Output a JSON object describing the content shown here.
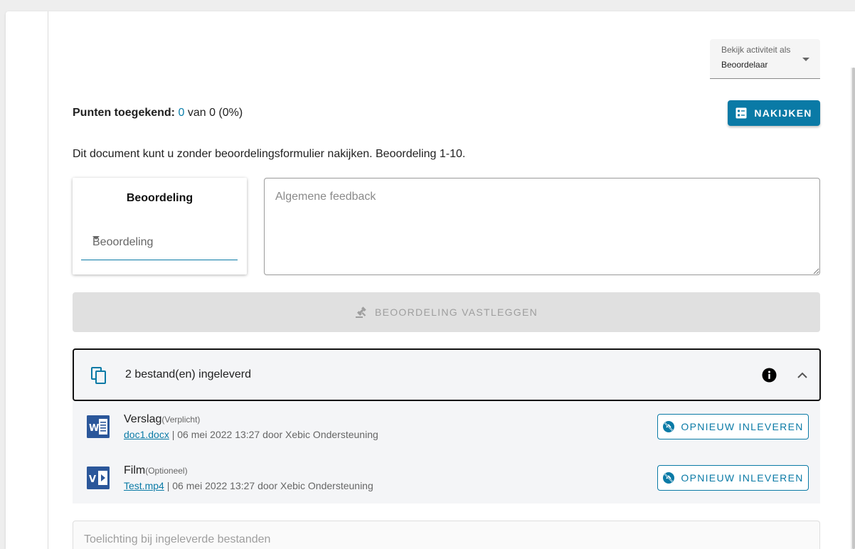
{
  "view_as": {
    "label": "Bekijk activiteit als",
    "value": "Beoordelaar"
  },
  "points": {
    "label": "Punten toegekend:",
    "awarded": "0",
    "rest": " van 0 (0%)"
  },
  "grade_button_label": "NAKIJKEN",
  "info_text": "Dit document kunt u zonder beoordelingsformulier nakijken. Beoordeling 1-10.",
  "grade_card": {
    "title": "Beoordeling",
    "select_placeholder": "Beoordeling"
  },
  "feedback_placeholder": "Algemene feedback",
  "submit_label": "BEOORDELING VASTLEGGEN",
  "files_header": "2 bestand(en) ingeleverd",
  "files": [
    {
      "name": "Verslag",
      "tag": "(Verplicht)",
      "file": "doc1.docx",
      "meta": " | 06 mei 2022 13:27 door Xebic Ondersteuning",
      "icon": "word-icon",
      "button": "OPNIEUW INLEVEREN"
    },
    {
      "name": "Film",
      "tag": "(Optioneel)",
      "file": "Test.mp4",
      "meta": " | 06 mei 2022 13:27 door Xebic Ondersteuning",
      "icon": "video-file-icon",
      "button": "OPNIEUW INLEVEREN"
    }
  ],
  "toelichting_placeholder": "Toelichting bij ingeleverde bestanden",
  "colors": {
    "accent": "#0a7aa6",
    "word": "#2b579a"
  }
}
